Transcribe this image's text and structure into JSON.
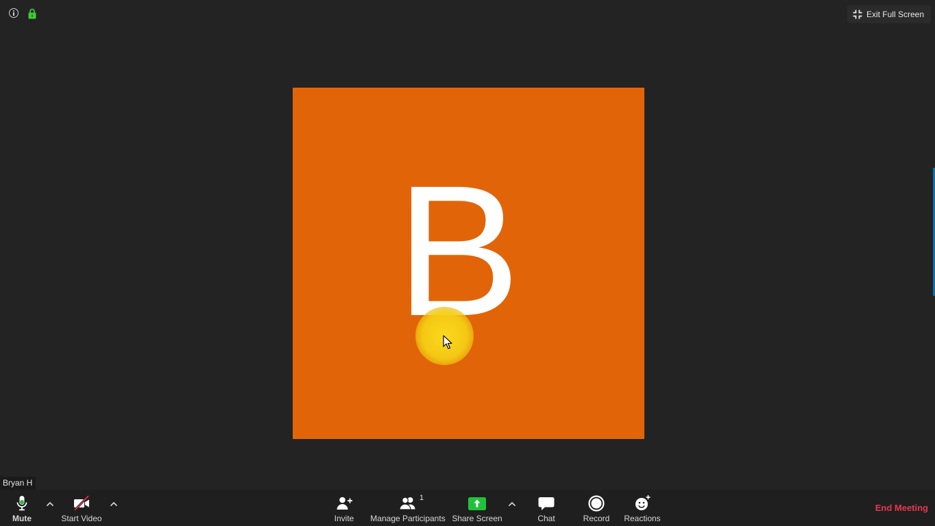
{
  "top_bar": {
    "info_icon": "info-icon",
    "lock_icon": "lock-icon",
    "exit_full_screen_label": "Exit Full Screen"
  },
  "avatar": {
    "initial": "B",
    "background_color": "#e16508"
  },
  "participant": {
    "name": "Bryan H"
  },
  "toolbar": {
    "mute_label": "Mute",
    "start_video_label": "Start Video",
    "invite_label": "Invite",
    "manage_participants_label": "Manage Participants",
    "participants_count": "1",
    "share_screen_label": "Share Screen",
    "chat_label": "Chat",
    "record_label": "Record",
    "reactions_label": "Reactions",
    "end_meeting_label": "End Meeting"
  },
  "colors": {
    "background": "#232323",
    "toolbar": "#1f1f1f",
    "share_green": "#23c13b",
    "lock_green": "#3fca33",
    "end_red": "#e8364f",
    "video_slash": "#e8364f",
    "cursor_highlight": "#f7d31b"
  }
}
